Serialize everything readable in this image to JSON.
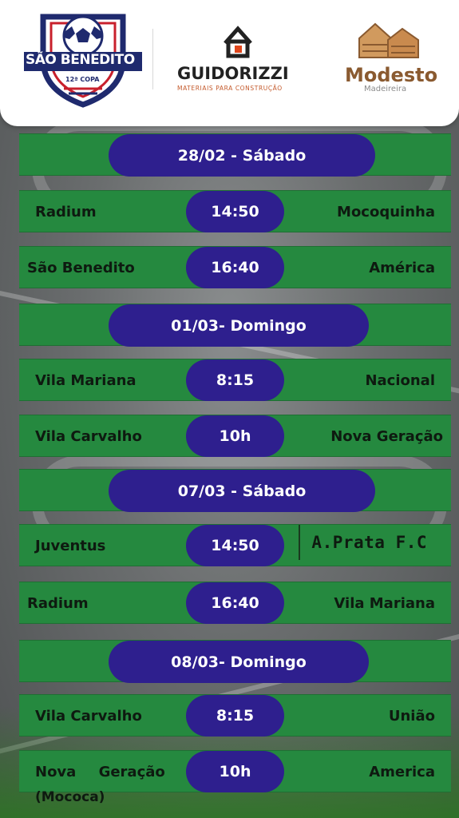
{
  "header": {
    "sponsor1": {
      "name": "SÃO BENEDITO",
      "sub": "12ª COPA"
    },
    "sponsor2": {
      "name": "GUIDORIZZI",
      "sub": "MATERIAIS PARA CONSTRUÇÃO"
    },
    "sponsor3": {
      "name": "Modesto",
      "sub": "Madeireira"
    }
  },
  "schedule": [
    {
      "type": "date",
      "label": "28/02 - Sábado"
    },
    {
      "type": "match",
      "home": "Radium",
      "time": "14:50",
      "away": "Mocoquinha"
    },
    {
      "type": "match",
      "home": "São Benedito",
      "time": "16:40",
      "away": "América"
    },
    {
      "type": "date",
      "label": "01/03- Domingo"
    },
    {
      "type": "match",
      "home": "Vila Mariana",
      "time": "8:15",
      "away": "Nacional"
    },
    {
      "type": "match",
      "home": "Vila Carvalho",
      "time": "10h",
      "away": "Nova Geração"
    },
    {
      "type": "date",
      "label": "07/03 - Sábado"
    },
    {
      "type": "match",
      "home": "Juventus",
      "time": "14:50",
      "away": "A.Prata F.C"
    },
    {
      "type": "match",
      "home": "Radium",
      "time": "16:40",
      "away": "Vila Mariana"
    },
    {
      "type": "date",
      "label": "08/03- Domingo"
    },
    {
      "type": "match",
      "home": "Vila Carvalho",
      "time": "8:15",
      "away": "União"
    },
    {
      "type": "match",
      "home": "Nova Geração",
      "time": "10h",
      "away": "America",
      "home_sub": "(Mococa)"
    }
  ],
  "colors": {
    "row_green": "#25893f",
    "pill_purple": "#2e1f8e",
    "text_dark": "#0e1a10",
    "header_bg": "#ffffff"
  }
}
